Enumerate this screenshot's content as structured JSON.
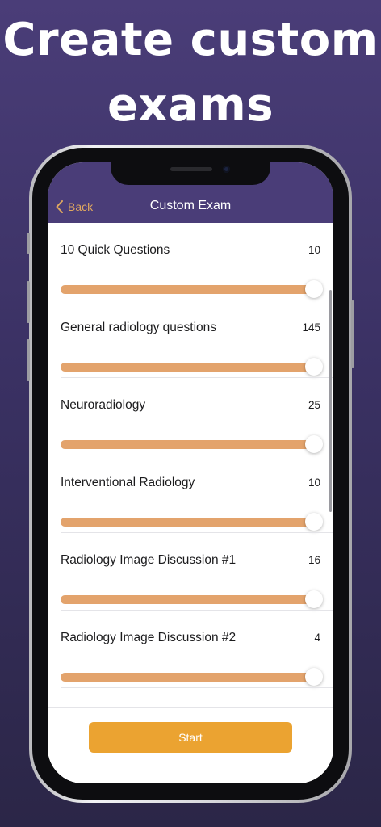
{
  "headline": {
    "line1": "Create custom",
    "line2": "exams"
  },
  "nav": {
    "back_label": "Back",
    "title": "Custom Exam",
    "back_icon": "chevron-left-icon"
  },
  "categories": [
    {
      "label": "10 Quick Questions",
      "count": "10",
      "slider_fraction": 1.0
    },
    {
      "label": "General radiology questions",
      "count": "145",
      "slider_fraction": 1.0
    },
    {
      "label": "Neuroradiology",
      "count": "25",
      "slider_fraction": 1.0
    },
    {
      "label": "Interventional Radiology",
      "count": "10",
      "slider_fraction": 1.0
    },
    {
      "label": "Radiology Image Discussion #1",
      "count": "16",
      "slider_fraction": 1.0
    },
    {
      "label": "Radiology Image Discussion #2",
      "count": "4",
      "slider_fraction": 1.0
    }
  ],
  "footer": {
    "start_label": "Start"
  },
  "colors": {
    "brand_purple": "#4a3d78",
    "accent_orange": "#eba331",
    "slider_track": "#e3a36c"
  }
}
